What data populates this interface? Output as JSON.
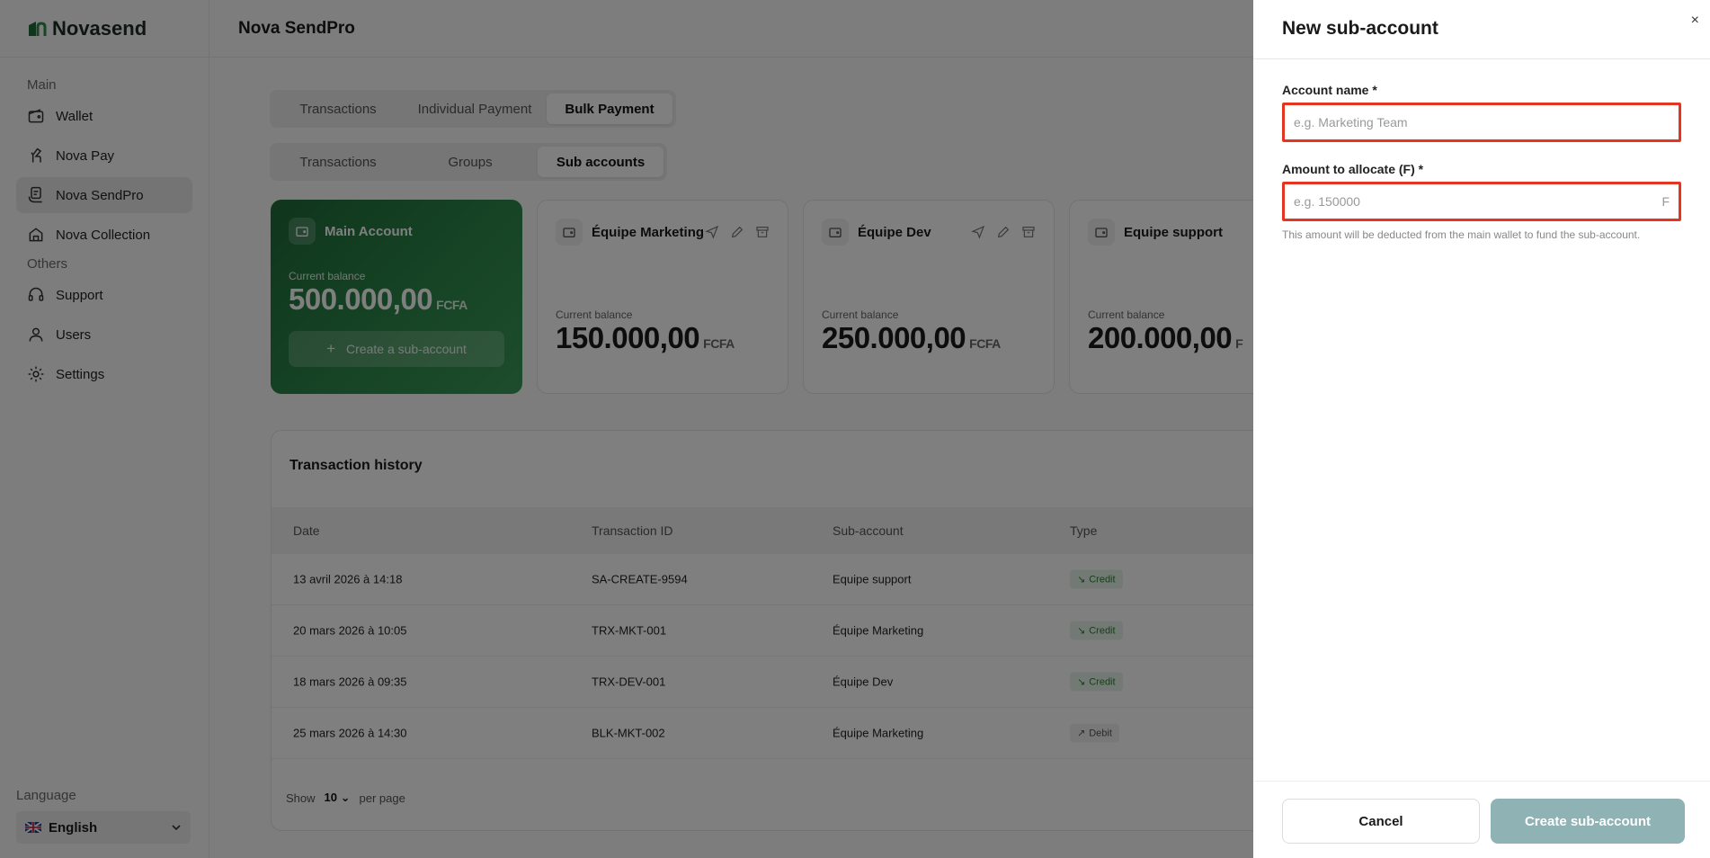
{
  "app": {
    "logo_text": "Novasend",
    "page_title": "Nova SendPro"
  },
  "sidebar": {
    "section_main": "Main",
    "section_others": "Others",
    "items_main": [
      {
        "label": "Wallet",
        "icon": "wallet-icon"
      },
      {
        "label": "Nova Pay",
        "icon": "hand-pay-icon"
      },
      {
        "label": "Nova SendPro",
        "icon": "sendpro-icon",
        "active": true
      },
      {
        "label": "Nova Collection",
        "icon": "collection-icon"
      }
    ],
    "items_others": [
      {
        "label": "Support",
        "icon": "headset-icon"
      },
      {
        "label": "Users",
        "icon": "user-icon"
      },
      {
        "label": "Settings",
        "icon": "gear-icon"
      }
    ],
    "language_label": "Language",
    "language_value": "English"
  },
  "tabs_primary": [
    "Transactions",
    "Individual Payment",
    "Bulk Payment"
  ],
  "tabs_secondary": [
    "Transactions",
    "Groups",
    "Sub accounts"
  ],
  "cards": {
    "main": {
      "name": "Main Account",
      "balance_label": "Current balance",
      "balance": "500.000,00",
      "currency": "FCFA",
      "create_label": "Create a sub-account"
    },
    "subs": [
      {
        "name": "Équipe Marketing",
        "balance_label": "Current balance",
        "balance": "150.000,00",
        "currency": "FCFA"
      },
      {
        "name": "Équipe Dev",
        "balance_label": "Current balance",
        "balance": "250.000,00",
        "currency": "FCFA"
      },
      {
        "name": "Equipe support",
        "balance_label": "Current balance",
        "balance": "200.000,00",
        "currency": "F"
      }
    ]
  },
  "history": {
    "title": "Transaction history",
    "columns": [
      "Date",
      "Transaction ID",
      "Sub-account",
      "Type"
    ],
    "rows": [
      {
        "date": "13 avril 2026 à 14:18",
        "id": "SA-CREATE-9594",
        "sub": "Equipe support",
        "type": "Credit"
      },
      {
        "date": "20 mars 2026 à 10:05",
        "id": "TRX-MKT-001",
        "sub": "Équipe Marketing",
        "type": "Credit"
      },
      {
        "date": "18 mars 2026 à 09:35",
        "id": "TRX-DEV-001",
        "sub": "Équipe Dev",
        "type": "Credit"
      },
      {
        "date": "25 mars 2026 à 14:30",
        "id": "BLK-MKT-002",
        "sub": "Équipe Marketing",
        "type": "Debit"
      }
    ],
    "pager": {
      "show": "Show",
      "value": "10",
      "per_page": "per page"
    }
  },
  "panel": {
    "title": "New sub-account",
    "close": "×",
    "name_label": "Account name *",
    "name_placeholder": "e.g. Marketing Team",
    "amount_label": "Amount to allocate (F) *",
    "amount_placeholder": "e.g. 150000",
    "amount_suffix": "F",
    "help": "This amount will be deducted from the main wallet to fund the sub-account.",
    "cancel": "Cancel",
    "create": "Create sub-account"
  },
  "colors": {
    "accent_green": "#2e8b4b",
    "highlight_red": "#e43521",
    "create_btn": "#8fb2b5"
  }
}
